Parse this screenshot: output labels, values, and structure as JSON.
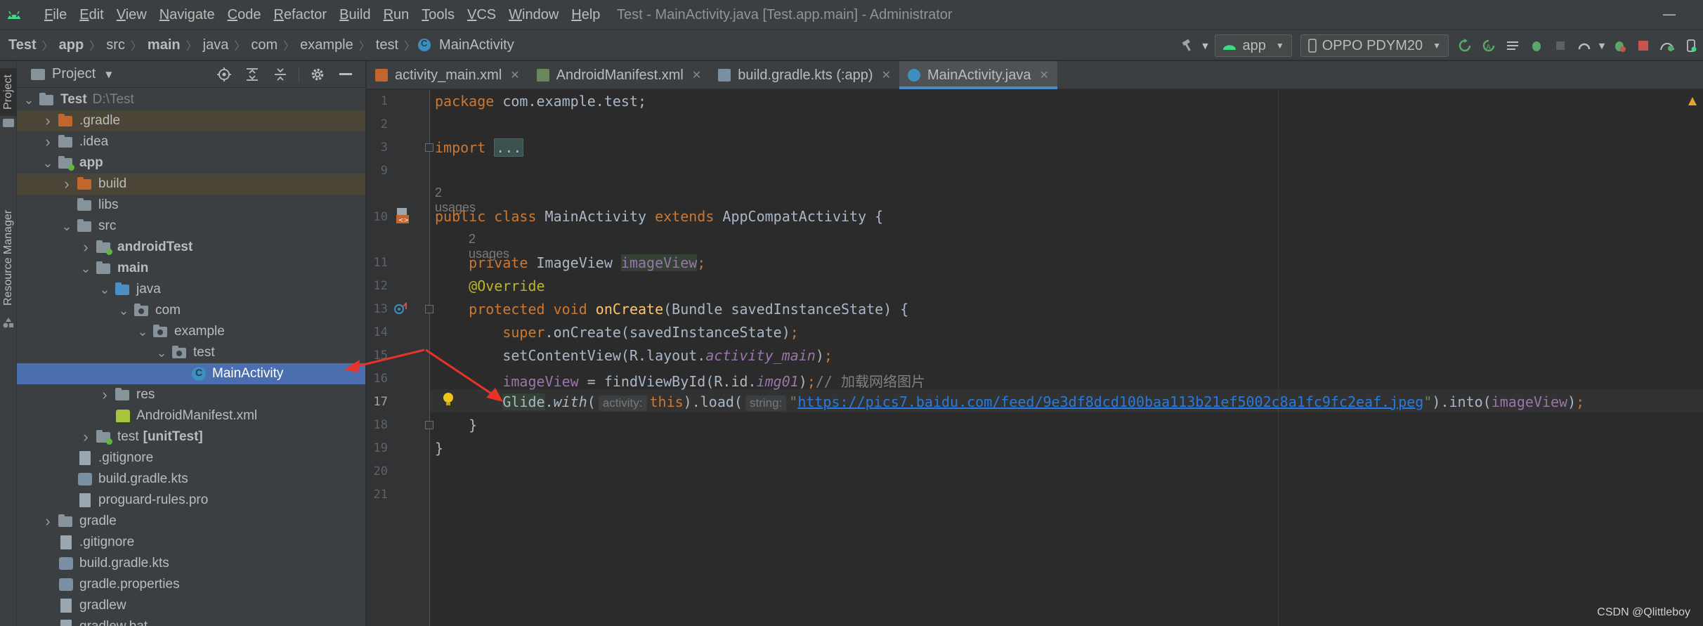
{
  "title_bar": {
    "menus": [
      {
        "label": "File",
        "underline": "F",
        "rest": "ile"
      },
      {
        "label": "Edit",
        "underline": "E",
        "rest": "dit"
      },
      {
        "label": "View",
        "underline": "V",
        "rest": "iew"
      },
      {
        "label": "Navigate",
        "underline": "N",
        "rest": "avigate"
      },
      {
        "label": "Code",
        "underline": "C",
        "rest": "ode"
      },
      {
        "label": "Refactor",
        "underline": "R",
        "rest": "efactor"
      },
      {
        "label": "Build",
        "underline": "B",
        "rest": "uild"
      },
      {
        "label": "Run",
        "underline": "R",
        "rest": "un"
      },
      {
        "label": "Tools",
        "underline": "T",
        "rest": "ools"
      },
      {
        "label": "VCS",
        "underline": "V",
        "rest": "CS"
      },
      {
        "label": "Window",
        "underline": "W",
        "rest": "indow"
      },
      {
        "label": "Help",
        "underline": "H",
        "rest": "elp"
      }
    ],
    "window_title": "Test - MainActivity.java [Test.app.main] - Administrator"
  },
  "breadcrumb": [
    "Test",
    "app",
    "src",
    "main",
    "java",
    "com",
    "example",
    "test",
    "MainActivity"
  ],
  "toolbar": {
    "run_config": "app",
    "device": "OPPO PDYM20"
  },
  "side_tabs": {
    "project": "Project",
    "resource_manager": "Resource Manager"
  },
  "project_panel": {
    "title": "Project",
    "tree": [
      {
        "label": "Test",
        "extra": "D:\\Test",
        "depth": 0,
        "chev": "open",
        "icon": "folder",
        "bold": true
      },
      {
        "label": ".gradle",
        "depth": 1,
        "chev": "closed",
        "icon": "folder-orange",
        "hl": true
      },
      {
        "label": ".idea",
        "depth": 1,
        "chev": "closed",
        "icon": "folder"
      },
      {
        "label": "app",
        "depth": 1,
        "chev": "open",
        "icon": "folder-module",
        "bold": true
      },
      {
        "label": "build",
        "depth": 2,
        "chev": "closed",
        "icon": "folder-orange",
        "hl": true
      },
      {
        "label": "libs",
        "depth": 2,
        "chev": "",
        "icon": "folder"
      },
      {
        "label": "src",
        "depth": 2,
        "chev": "open",
        "icon": "folder"
      },
      {
        "label": "androidTest",
        "depth": 3,
        "chev": "closed",
        "icon": "folder-module",
        "bold": true
      },
      {
        "label": "main",
        "depth": 3,
        "chev": "open",
        "icon": "folder",
        "bold": true
      },
      {
        "label": "java",
        "depth": 4,
        "chev": "open",
        "icon": "folder-blue"
      },
      {
        "label": "com",
        "depth": 5,
        "chev": "open",
        "icon": "folder-pkg"
      },
      {
        "label": "example",
        "depth": 6,
        "chev": "open",
        "icon": "folder-pkg"
      },
      {
        "label": "test",
        "depth": 7,
        "chev": "open",
        "icon": "folder-pkg"
      },
      {
        "label": "MainActivity",
        "depth": 8,
        "chev": "",
        "icon": "class",
        "sel": true
      },
      {
        "label": "res",
        "depth": 4,
        "chev": "closed",
        "icon": "folder"
      },
      {
        "label": "AndroidManifest.xml",
        "depth": 4,
        "chev": "",
        "icon": "manifest"
      },
      {
        "label": "test",
        "extra_bold": "[unitTest]",
        "depth": 3,
        "chev": "closed",
        "icon": "folder-module"
      },
      {
        "label": ".gitignore",
        "depth": 2,
        "chev": "",
        "icon": "file"
      },
      {
        "label": "build.gradle.kts",
        "depth": 2,
        "chev": "",
        "icon": "gradle"
      },
      {
        "label": "proguard-rules.pro",
        "depth": 2,
        "chev": "",
        "icon": "file"
      },
      {
        "label": "gradle",
        "depth": 1,
        "chev": "closed",
        "icon": "folder"
      },
      {
        "label": ".gitignore",
        "depth": 1,
        "chev": "",
        "icon": "file"
      },
      {
        "label": "build.gradle.kts",
        "depth": 1,
        "chev": "",
        "icon": "gradle"
      },
      {
        "label": "gradle.properties",
        "depth": 1,
        "chev": "",
        "icon": "gradle"
      },
      {
        "label": "gradlew",
        "depth": 1,
        "chev": "",
        "icon": "file"
      },
      {
        "label": "gradlew.bat",
        "depth": 1,
        "chev": "",
        "icon": "file"
      }
    ]
  },
  "editor_tabs": [
    {
      "label": "activity_main.xml",
      "icon_color": "#c4652b",
      "active": false
    },
    {
      "label": "AndroidManifest.xml",
      "icon_color": "#6a8759",
      "active": false
    },
    {
      "label": "build.gradle.kts (:app)",
      "icon_color": "#7b8fa3",
      "active": false
    },
    {
      "label": "MainActivity.java",
      "icon_color": "#3d8fbf",
      "active": true
    }
  ],
  "editor": {
    "line_numbers": [
      "1",
      "2",
      "3",
      "9",
      "10",
      "11",
      "12",
      "13",
      "14",
      "15",
      "16",
      "17",
      "18",
      "19",
      "20",
      "21"
    ],
    "usages_class": "2 usages",
    "usages_field": "2 usages",
    "code": {
      "l1_kw": "package",
      "l1_rest": " com.example.test;",
      "l3_kw": "import",
      "l3_fold": "...",
      "l10_kw1": "public class",
      "l10_name": " MainActivity ",
      "l10_kw2": "extends",
      "l10_rest": " AppCompatActivity {",
      "l11_kw": "private",
      "l11_type": " ImageView ",
      "l11_field": "imageView",
      "l11_semi": ";",
      "l12_ann": "@Override",
      "l13_kw": "protected void",
      "l13_fn": "onCreate",
      "l13_rest": "(Bundle savedInstanceState) {",
      "l14_kw": "super",
      "l14_rest": ".onCreate(savedInstanceState)",
      "l14_semi": ";",
      "l15_a": "setContentView(R.layout.",
      "l15_field": "activity_main",
      "l15_b": ")",
      "l15_semi": ";",
      "l16_field": "imageView",
      "l16_a": " = findViewById(R.id.",
      "l16_id": "img01",
      "l16_b": ")",
      "l16_semi": ";",
      "l16_cmt": "// 加载网络图片",
      "l17_glide": "Glide",
      "l17_dot": ".",
      "l17_with": "with",
      "l17_paren": "(",
      "l17_hint1": "activity:",
      "l17_this": "this",
      "l17_load": ").load(",
      "l17_hint2": "string:",
      "l17_q1": "\"",
      "l17_url": "https://pics7.baidu.com/feed/9e3df8dcd100baa113b21ef5002c8a1fc9fc2eaf.jpeg",
      "l17_q2": "\"",
      "l17_into": ").into(",
      "l17_field": "imageView",
      "l17_end": ")",
      "l17_semi": ";",
      "l18": "}",
      "l19": "}"
    }
  },
  "watermark": "CSDN @Qlittleboy",
  "colors": {
    "accent": "#4a88c7",
    "selection": "#4b6eaf",
    "arrow": "#e8332a"
  }
}
